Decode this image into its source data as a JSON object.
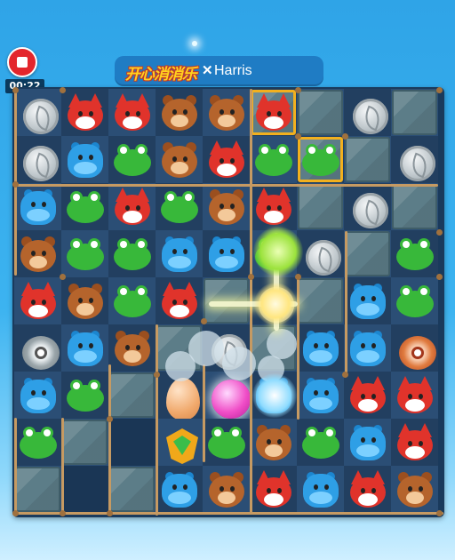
{
  "header": {
    "game_logo": "开心消消乐",
    "player_name": "Harris"
  },
  "recorder": {
    "elapsed": "00:22"
  },
  "icons": {
    "record_stop": "stop-icon",
    "close": "close-icon"
  },
  "colors": {
    "sky": "#3cb3f0",
    "board_bg": "#1a3a5c",
    "fox": "#e0332b",
    "bear": "#b5642c",
    "frog": "#38b83a",
    "hippo": "#2e9fe6",
    "rope": "#c69a62",
    "stone": "#5c7d88"
  },
  "board": {
    "grid": [
      [
        "coin",
        "fox",
        "fox",
        "bear",
        "bear",
        "fox*",
        "stone",
        "coin",
        "stone"
      ],
      [
        "coin",
        "hippo",
        "frog",
        "bear",
        "fox",
        "frog",
        "frog*",
        "stone",
        "coin"
      ],
      [
        "hippo",
        "frog",
        "fox",
        "frog",
        "bear",
        "fox",
        "stone",
        "coin",
        "stone"
      ],
      [
        "bear",
        "frog",
        "frog",
        "hippo",
        "hippo",
        "frog",
        "coin",
        "stone",
        "frog"
      ],
      [
        "fox",
        "bear",
        "frog",
        "fox",
        "stone",
        "coin",
        "stone",
        "hippo",
        "frog"
      ],
      [
        "cannon",
        "hippo",
        "bear",
        "stone",
        "coin",
        "stone",
        "hippo",
        "hippo",
        "cannon-red"
      ],
      [
        "hippo",
        "frog",
        "stone",
        "orb",
        "rainbow",
        "hippo",
        "hippo",
        "fox",
        "fox"
      ],
      [
        "frog",
        "stone",
        "empty",
        "shield",
        "frog",
        "bear",
        "frog",
        "hippo",
        "fox"
      ],
      [
        "stone",
        "empty",
        "stone",
        "hippo",
        "bear",
        "fox",
        "hippo",
        "fox",
        "bear"
      ]
    ]
  }
}
